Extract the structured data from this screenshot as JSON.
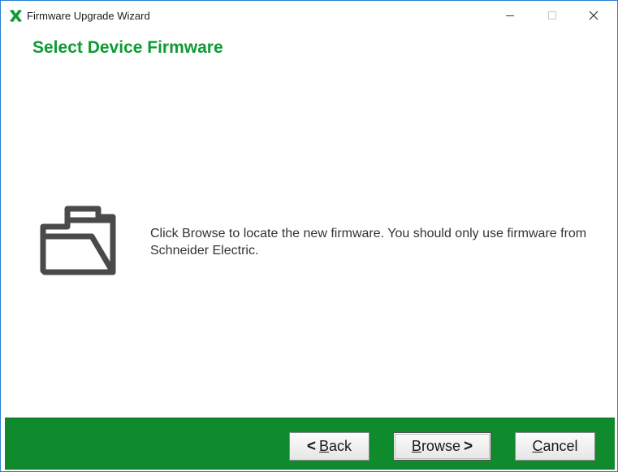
{
  "window": {
    "title": "Firmware Upgrade Wizard",
    "accent_color": "#0f9a35",
    "footer_color": "#0f8a2c",
    "controls": {
      "minimize_icon": "minimize-icon",
      "maximize_icon": "maximize-icon",
      "close_icon": "close-icon"
    }
  },
  "header": {
    "title": "Select Device Firmware"
  },
  "main": {
    "icon": "folder-open-icon",
    "message": "Click Browse to locate the new firmware. You should only use firmware from Schneider Electric."
  },
  "footer": {
    "back_label": "Back",
    "browse_label": "Browse",
    "cancel_label": "Cancel",
    "back_arrow": "<",
    "browse_arrow": ">"
  }
}
